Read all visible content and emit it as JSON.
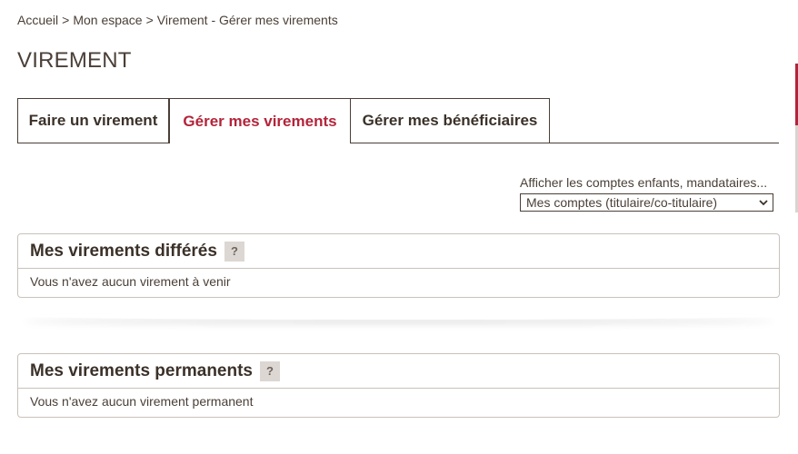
{
  "breadcrumb": {
    "items": [
      "Accueil",
      "Mon espace",
      "Virement - Gérer mes virements"
    ],
    "separator": ">"
  },
  "page": {
    "title": "VIREMENT"
  },
  "tabs": [
    {
      "label": "Faire un virement",
      "active": false
    },
    {
      "label": "Gérer mes virements",
      "active": true
    },
    {
      "label": "Gérer mes bénéficiaires",
      "active": false
    }
  ],
  "filter": {
    "label": "Afficher les comptes enfants, mandataires...",
    "selected": "Mes comptes (titulaire/co-titulaire)"
  },
  "panels": [
    {
      "title": "Mes virements différés",
      "help": "?",
      "message": "Vous n'avez aucun virement à venir"
    },
    {
      "title": "Mes virements permanents",
      "help": "?",
      "message": "Vous n'avez aucun virement permanent"
    }
  ],
  "icons": {
    "help": "question-icon",
    "select": "chevron-down-icon"
  },
  "colors": {
    "accent": "#b3243a",
    "text": "#4a3f37",
    "border": "#c9c1bb"
  }
}
